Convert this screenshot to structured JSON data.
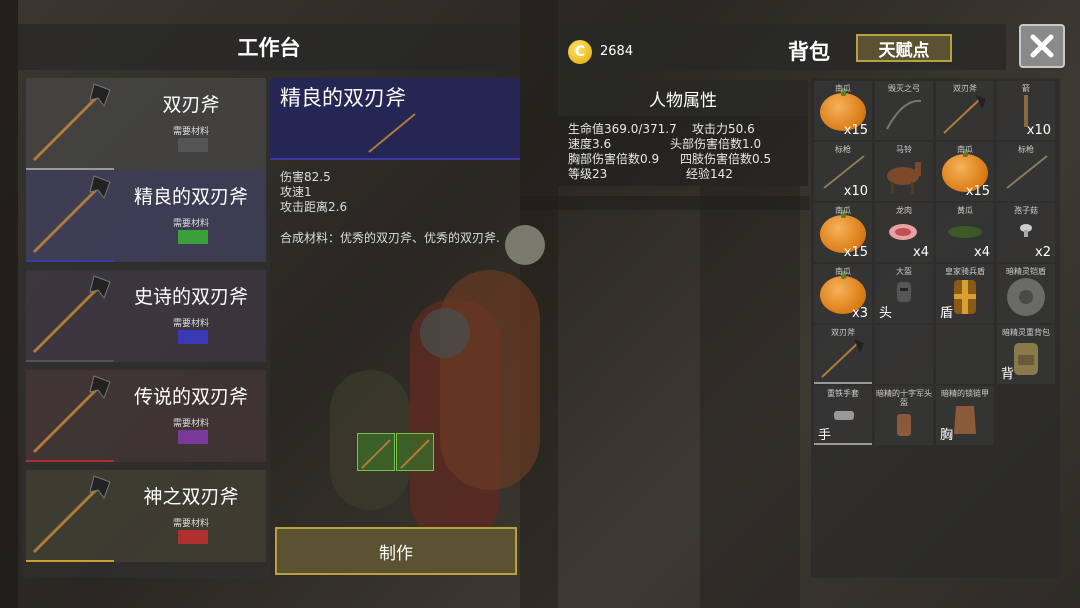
{
  "workbench": {
    "title": "工作台",
    "recipes": [
      {
        "name": "双刃斧",
        "requirement_label": "需要材料",
        "material_color": "#555555",
        "underline_color": "#999999"
      },
      {
        "name": "精良的双刃斧",
        "requirement_label": "需要材料",
        "material_color": "#3aa03a",
        "underline_color": "#3a3aa8"
      },
      {
        "name": "史诗的双刃斧",
        "requirement_label": "需要材料",
        "material_color": "#3a3ab8",
        "underline_color": "#555555"
      },
      {
        "name": "传说的双刃斧",
        "requirement_label": "需要材料",
        "material_color": "#7a3a9a",
        "underline_color": "#b03030"
      },
      {
        "name": "神之双刃斧",
        "requirement_label": "需要材料",
        "material_color": "#b03030",
        "underline_color": "#c8a030"
      }
    ],
    "selected": {
      "name": "精良的双刃斧",
      "stats": [
        "伤害82.5",
        "攻速1",
        "攻击距离2.6"
      ],
      "materials": "合成材料：优秀的双刃斧、优秀的双刃斧."
    },
    "craft_button": "制作"
  },
  "backpack": {
    "title": "背包",
    "coins": "2684",
    "talent_button": "天赋点"
  },
  "attributes": {
    "title": "人物属性",
    "hp": "生命值369.0/371.7",
    "attack": "攻击力50.6",
    "speed": "速度3.6",
    "head_mult": "头部伤害倍数1.0",
    "chest_mult": "胸部伤害倍数0.9",
    "limb_mult": "四肢伤害倍数0.5",
    "level": "等级23",
    "exp": "经验142"
  },
  "inventory": {
    "slots": [
      {
        "label": "南瓜",
        "qty": "x15",
        "icon": "pumpkin"
      },
      {
        "label": "毁灭之弓",
        "qty": "",
        "icon": "bow"
      },
      {
        "label": "双刃斧",
        "qty": "",
        "icon": "double-axe"
      },
      {
        "label": "箭",
        "qty": "x10",
        "icon": "arrow"
      },
      {
        "label": "标枪",
        "qty": "x10",
        "icon": "javelin"
      },
      {
        "label": "马铃",
        "qty": "",
        "icon": "horse"
      },
      {
        "label": "南瓜",
        "qty": "x15",
        "icon": "pumpkin"
      },
      {
        "label": "标枪",
        "qty": "",
        "icon": "javelin"
      },
      {
        "label": "南瓜",
        "qty": "x15",
        "icon": "pumpkin"
      },
      {
        "label": "龙肉",
        "qty": "x4",
        "icon": "meat"
      },
      {
        "label": "黄瓜",
        "qty": "x4",
        "icon": "cucumber"
      },
      {
        "label": "孢子菇",
        "qty": "x2",
        "icon": "mushroom"
      },
      {
        "label": "南瓜",
        "qty": "x3",
        "icon": "pumpkin"
      },
      {
        "label": "大盔",
        "tag": "头",
        "icon": "helmet"
      },
      {
        "label": "皇家骑兵盾",
        "tag": "盾",
        "icon": "shield"
      },
      {
        "label": "暗精灵铠盾",
        "tag": "",
        "icon": "round-shield"
      },
      {
        "label": "双刃斧",
        "qty": "",
        "icon": "double-axe"
      },
      {
        "label": "",
        "qty": "",
        "icon": "empty"
      },
      {
        "label": "",
        "qty": "",
        "icon": "empty"
      },
      {
        "label": "暗精灵重背包",
        "tag": "背",
        "icon": "backpack"
      },
      {
        "label": "重铁手套",
        "tag": "手",
        "icon": "glove"
      },
      {
        "label": "暗精的十字军头盔",
        "tag": "",
        "icon": "crusader-helm"
      },
      {
        "label": "暗精的锁链甲",
        "tag": "胸",
        "icon": "chainmail"
      }
    ]
  }
}
